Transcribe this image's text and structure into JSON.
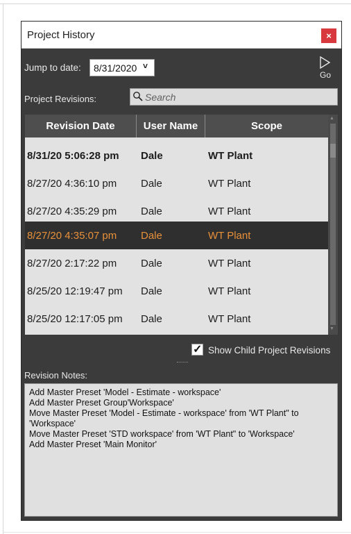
{
  "window": {
    "title": "Project History",
    "close_glyph": "×"
  },
  "toolbar": {
    "jump_label": "Jump to date:",
    "date_value": "8/31/2020",
    "go_label": "Go",
    "go_icon": "play-triangle-icon"
  },
  "revisions": {
    "label": "Project Revisions:",
    "search_placeholder": "Search",
    "columns": [
      "Revision Date",
      "User Name",
      "Scope"
    ],
    "rows": [
      {
        "date": "8/31/20 5:06:28 pm",
        "user": "Dale",
        "scope": "WT Plant",
        "state": "current"
      },
      {
        "date": "8/27/20 4:36:10 pm",
        "user": "Dale",
        "scope": "WT Plant",
        "state": "normal"
      },
      {
        "date": "8/27/20 4:35:29 pm",
        "user": "Dale",
        "scope": "WT Plant",
        "state": "normal"
      },
      {
        "date": "8/27/20 4:35:07 pm",
        "user": "Dale",
        "scope": "WT Plant",
        "state": "selected"
      },
      {
        "date": "8/27/20 2:17:22 pm",
        "user": "Dale",
        "scope": "WT Plant",
        "state": "normal"
      },
      {
        "date": "8/25/20 12:19:47 pm",
        "user": "Dale",
        "scope": "WT Plant",
        "state": "normal"
      },
      {
        "date": "8/25/20 12:17:05 pm",
        "user": "Dale",
        "scope": "WT Plant",
        "state": "normal"
      }
    ]
  },
  "show_child": {
    "label": "Show Child Project Revisions",
    "checked": true
  },
  "notes": {
    "label": "Revision Notes:",
    "lines": [
      "Add Master Preset 'Model - Estimate - workspace'",
      "Add Master Preset Group'Workspace'",
      "Move Master Preset 'Model - Estimate - workspace' from 'WT Plant\" to 'Workspace'",
      "Move Master Preset 'STD workspace' from 'WT Plant\" to 'Workspace'",
      "Add Master Preset 'Main Monitor'"
    ]
  },
  "colors": {
    "panel_bg": "#3b3b3b",
    "header_bg": "#4e4e4e",
    "selected_row_bg": "#2f2f2f",
    "selected_text": "#e8913a",
    "close_red": "#d8393e"
  }
}
